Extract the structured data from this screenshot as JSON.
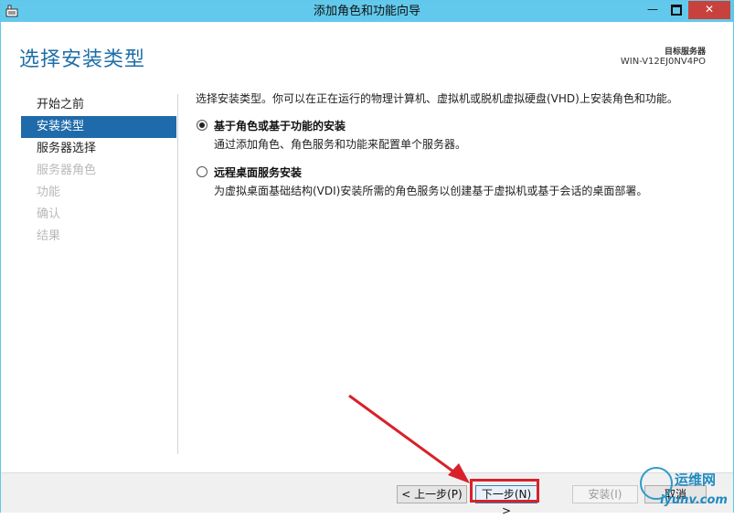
{
  "window": {
    "title": "添加角色和功能向导",
    "controls": {
      "minimize": "—",
      "maximize": "",
      "close": "✕"
    }
  },
  "header": {
    "page_title": "选择安装类型",
    "target_server_label": "目标服务器",
    "target_server_name": "WIN-V12EJ0NV4PO"
  },
  "nav": {
    "items": [
      {
        "label": "开始之前",
        "state": "normal"
      },
      {
        "label": "安装类型",
        "state": "selected"
      },
      {
        "label": "服务器选择",
        "state": "normal"
      },
      {
        "label": "服务器角色",
        "state": "disabled"
      },
      {
        "label": "功能",
        "state": "disabled"
      },
      {
        "label": "确认",
        "state": "disabled"
      },
      {
        "label": "结果",
        "state": "disabled"
      }
    ]
  },
  "content": {
    "intro": "选择安装类型。你可以在正在运行的物理计算机、虚拟机或脱机虚拟硬盘(VHD)上安装角色和功能。",
    "options": [
      {
        "title": "基于角色或基于功能的安装",
        "description": "通过添加角色、角色服务和功能来配置单个服务器。",
        "checked": true
      },
      {
        "title": "远程桌面服务安装",
        "description": "为虚拟桌面基础结构(VDI)安装所需的角色服务以创建基于虚拟机或基于会话的桌面部署。",
        "checked": false
      }
    ]
  },
  "footer": {
    "prev_label": "< 上一步(P)",
    "next_label": "下一步(N) >",
    "install_label": "安装(I)",
    "cancel_label": "取消"
  },
  "watermark": {
    "line1": "运维网",
    "line2": "iyunv.com"
  },
  "colors": {
    "titlebar": "#62c9ec",
    "accent": "#1f6aaa",
    "highlight": "#d8222a"
  }
}
